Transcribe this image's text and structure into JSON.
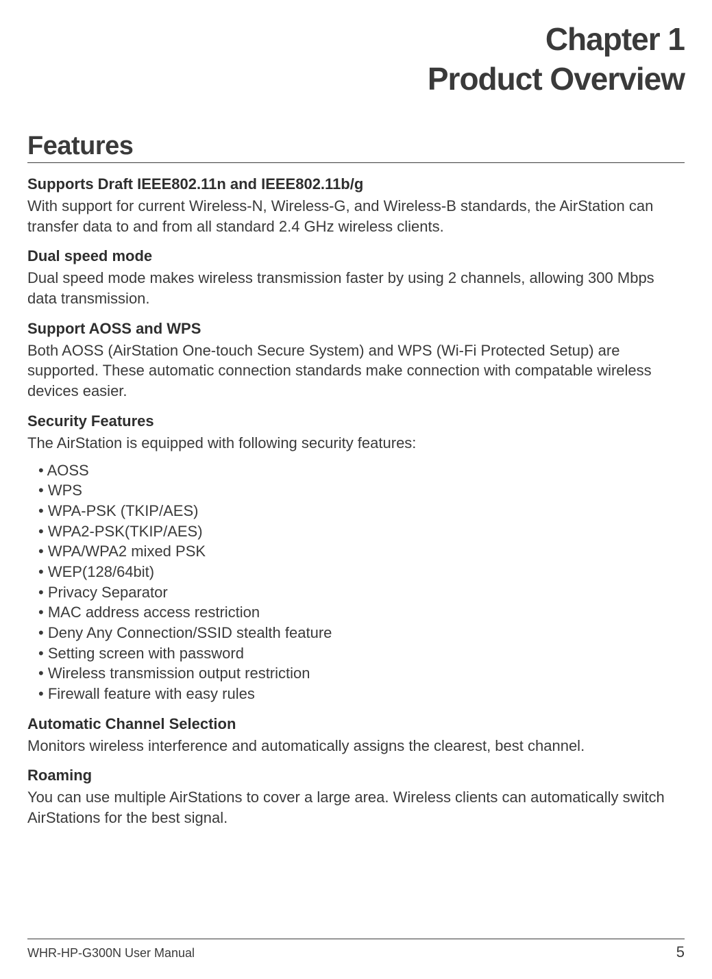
{
  "chapter": {
    "number_label": "Chapter 1",
    "title": "Product Overview"
  },
  "section_title": "Features",
  "features": {
    "f1": {
      "heading": "Supports Draft IEEE802.11n and IEEE802.11b/g",
      "body": "With support for current Wireless-N, Wireless-G, and Wireless-B standards, the AirStation can transfer data to and from all standard 2.4 GHz wireless clients."
    },
    "f2": {
      "heading": "Dual speed mode",
      "body": "Dual speed mode makes wireless transmission faster by using 2 channels, allowing 300 Mbps data transmission."
    },
    "f3": {
      "heading": "Support AOSS and WPS",
      "body": "Both AOSS (AirStation One-touch Secure System) and WPS (Wi-Fi Protected Setup) are supported. These automatic connection standards make connection with compatable wireless devices easier."
    },
    "f4": {
      "heading": "Security Features",
      "body": "The AirStation is equipped with following security features:",
      "bullets": {
        "b0": "• AOSS",
        "b1": "• WPS",
        "b2": "• WPA-PSK (TKIP/AES)",
        "b3": "• WPA2-PSK(TKIP/AES)",
        "b4": "• WPA/WPA2 mixed PSK",
        "b5": "• WEP(128/64bit)",
        "b6": "• Privacy Separator",
        "b7": "• MAC address access restriction",
        "b8": "• Deny Any Connection/SSID stealth feature",
        "b9": "• Setting screen with password",
        "b10": "• Wireless transmission output restriction",
        "b11": "• Firewall feature with easy rules"
      }
    },
    "f5": {
      "heading": "Automatic Channel Selection",
      "body": "Monitors wireless interference and automatically assigns the clearest, best channel."
    },
    "f6": {
      "heading": "Roaming",
      "body": "You can use multiple AirStations to cover a large area. Wireless clients can automatically switch AirStations for the best signal."
    }
  },
  "footer": {
    "left": "WHR-HP-G300N User Manual",
    "page": "5"
  }
}
